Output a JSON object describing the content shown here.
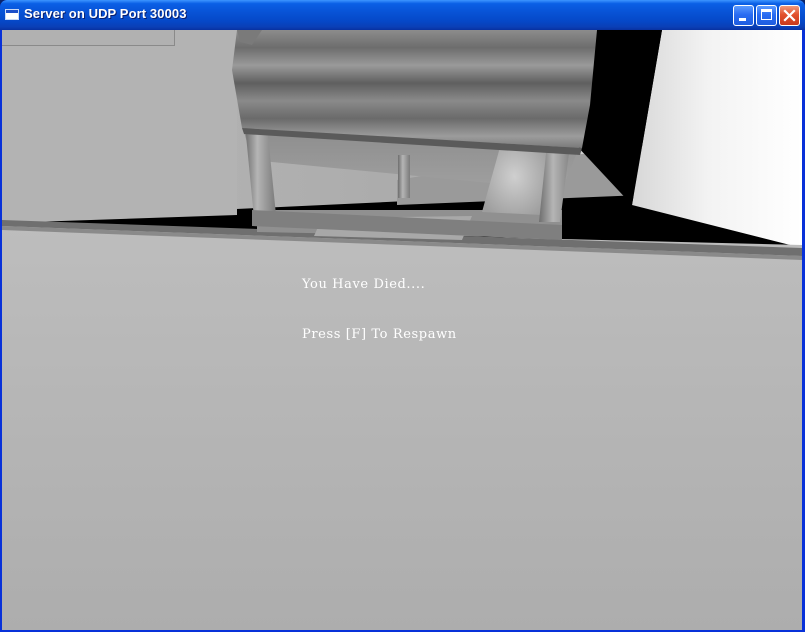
{
  "window": {
    "title": "Server on UDP Port 30003"
  },
  "icons": {
    "app": "app-window-icon",
    "minimize": "minimize-icon",
    "maximize": "maximize-icon",
    "close": "close-icon"
  },
  "hud": {
    "death_message": "You Have Died....",
    "respawn_prompt": "Press [F] To Respawn"
  },
  "colors": {
    "titlebar": "#0853d6",
    "close_button": "#e2512d",
    "hud_text": "#ffffff",
    "floor": "#b4b4b4"
  }
}
